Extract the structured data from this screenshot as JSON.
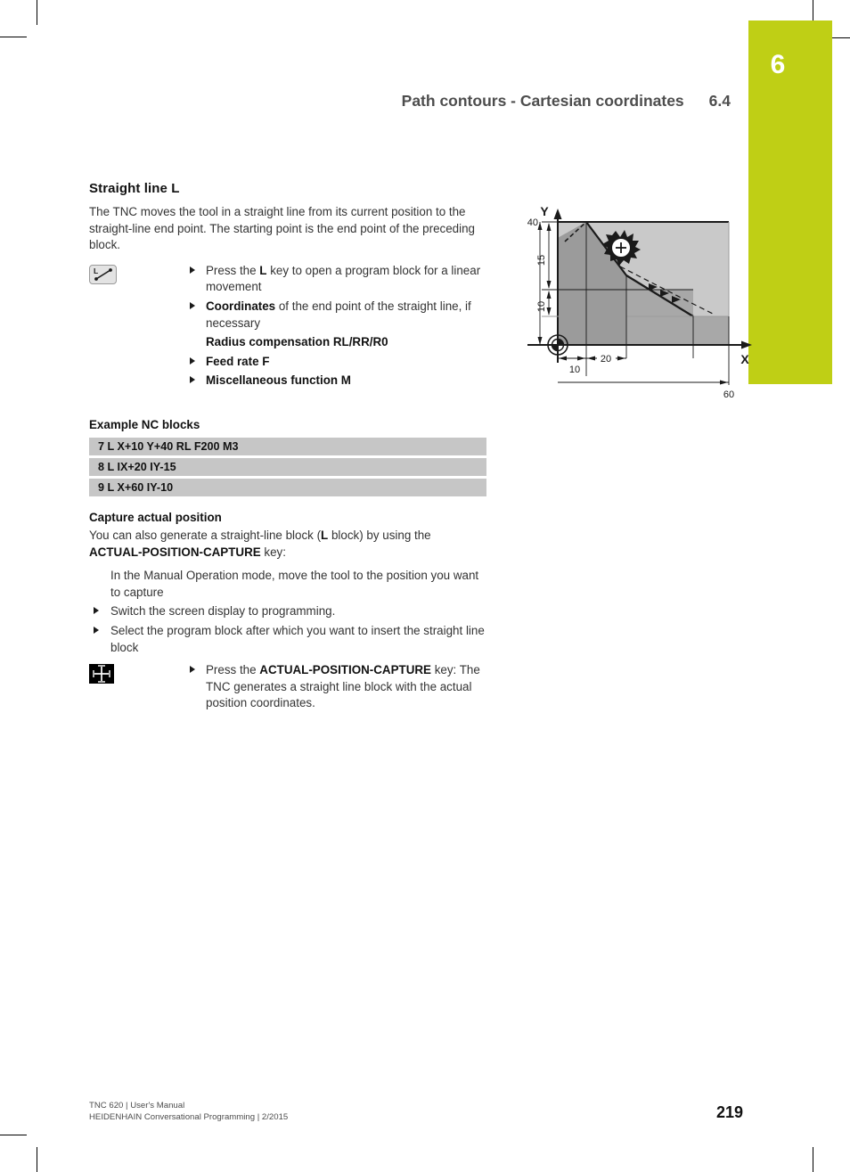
{
  "chapter": {
    "number": "6",
    "accent_color": "#bfcf15"
  },
  "header": {
    "title": "Path contours - Cartesian coordinates",
    "section": "6.4"
  },
  "section": {
    "title": "Straight line L",
    "intro": "The TNC moves the tool in a straight line from its current position to the straight-line end point. The starting point is the end point of the preceding block.",
    "key_icon": "straight-line-L-key",
    "steps": [
      {
        "prefix": "Press the ",
        "bold": "L",
        "suffix": " key to open a program block for a linear movement",
        "style": "normal"
      },
      {
        "prefix": "",
        "bold": "Coordinates",
        "suffix": " of the end point of the straight line, if necessary",
        "style": "normal"
      },
      {
        "prefix": "",
        "bold": "Radius compensation RL/RR/R0",
        "suffix": "",
        "style": "bold"
      },
      {
        "prefix": "",
        "bold": "Feed rate F",
        "suffix": "",
        "style": "bold"
      },
      {
        "prefix": "",
        "bold": "Miscellaneous function M",
        "suffix": "",
        "style": "bold"
      }
    ]
  },
  "nc_example": {
    "title": "Example NC blocks",
    "blocks": [
      "7 L X+10 Y+40 RL F200 M3",
      "8 L IX+20 IY-15",
      "9 L X+60 IY-10"
    ]
  },
  "capture": {
    "title": "Capture actual position",
    "intro_1": "You can also generate a straight-line block (",
    "intro_bold_1": "L",
    "intro_2": " block) by using the ",
    "intro_bold_2": "ACTUAL-POSITION-CAPTURE",
    "intro_3": " key:",
    "steps": [
      "In the Manual Operation mode, move the tool to the position you want to capture",
      "Switch the screen display to programming.",
      "Select the program block after which you want to insert the straight line block"
    ],
    "key_icon": "actual-position-capture-key",
    "final_step": {
      "prefix": "Press the ",
      "bold": "ACTUAL-POSITION-CAPTURE",
      "suffix": " key: The TNC generates a straight line block with the actual position coordinates."
    }
  },
  "diagram": {
    "name": "cartesian-contour-diagram",
    "axis_x_label": "X",
    "axis_y_label": "Y",
    "y_top_label": "40",
    "y_dims": [
      "15",
      "10"
    ],
    "x_dims": [
      "10",
      "20",
      "60"
    ],
    "origin_marker": "workpiece-datum-icon",
    "tool_marker": "milling-cutter-icon",
    "colors": {
      "workpiece_light": "#c9c9c9",
      "workpiece_mid": "#a8a8a8",
      "workpiece_dark": "#9b9b9b",
      "outline": "#1a1a1a"
    }
  },
  "footer": {
    "line1": "TNC 620 | User's Manual",
    "line2": "HEIDENHAIN Conversational Programming | 2/2015",
    "page_number": "219"
  }
}
